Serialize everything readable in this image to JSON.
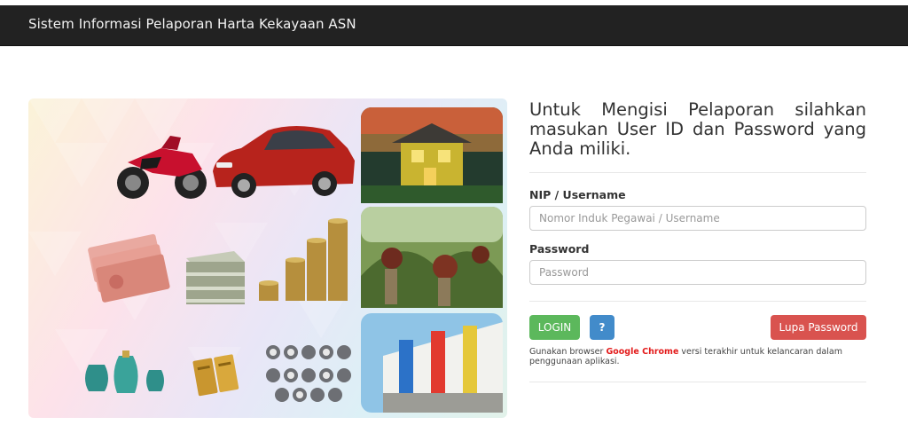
{
  "navbar": {
    "title": "Sistem Informasi Pelaporan Harta Kekayaan ASN"
  },
  "hero": {
    "description_icons": [
      "motorcycle-icon",
      "car-icon",
      "house-icon",
      "banknotes-icon",
      "cash-stack-icon",
      "coin-stacks-icon",
      "palm-plantation-icon",
      "vase-icon",
      "gold-bar-icon",
      "watch-icon",
      "shophouse-icon"
    ]
  },
  "login": {
    "heading": "Untuk Mengisi Pelaporan silahkan masukan User ID dan Password yang Anda miliki.",
    "username_label": "NIP / Username",
    "username_placeholder": "Nomor Induk Pegawai / Username",
    "password_label": "Password",
    "password_placeholder": "Password",
    "login_button": "LOGIN",
    "help_button": "?",
    "forgot_button": "Lupa Password",
    "note_prefix": "Gunakan browser ",
    "note_highlight": "Google Chrome",
    "note_suffix": " versi terakhir untuk kelancaran dalam penggunaan aplikasi."
  },
  "colors": {
    "navbar": "#222222",
    "login": "#5cb85c",
    "help": "#428bca",
    "forgot": "#d9534f",
    "highlight": "#e31b1b"
  }
}
